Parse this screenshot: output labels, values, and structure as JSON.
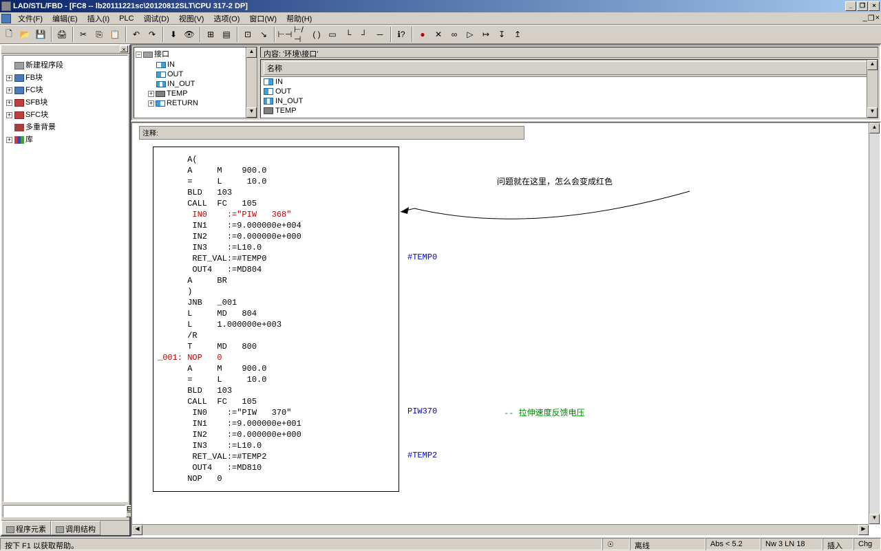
{
  "title": "LAD/STL/FBD  - [FC8 -- lb20111221sc\\20120812SLT\\CPU 317-2 DP]",
  "menus": [
    "文件(F)",
    "编辑(E)",
    "插入(I)",
    "PLC",
    "调试(D)",
    "视图(V)",
    "选项(O)",
    "窗口(W)",
    "帮助(H)"
  ],
  "tree": {
    "items": [
      {
        "icon": "new",
        "label": "新建程序段",
        "exp": ""
      },
      {
        "icon": "fb",
        "label": "FB块",
        "exp": "+"
      },
      {
        "icon": "fc",
        "label": "FC块",
        "exp": "+"
      },
      {
        "icon": "sfb",
        "label": "SFB块",
        "exp": "+"
      },
      {
        "icon": "sfc",
        "label": "SFC块",
        "exp": "+"
      },
      {
        "icon": "multi",
        "label": "多重背景",
        "exp": ""
      },
      {
        "icon": "lib",
        "label": "库",
        "exp": "+"
      }
    ]
  },
  "bottom_tabs": [
    "程序元素",
    "调用结构"
  ],
  "interface": {
    "root": "接口",
    "items": [
      {
        "icon": "in",
        "label": "IN",
        "exp": ""
      },
      {
        "icon": "out",
        "label": "OUT",
        "exp": ""
      },
      {
        "icon": "io",
        "label": "IN_OUT",
        "exp": ""
      },
      {
        "icon": "temp",
        "label": "TEMP",
        "exp": "+"
      },
      {
        "icon": "ret",
        "label": "RETURN",
        "exp": "+"
      }
    ]
  },
  "content_label": "内容:  '环境\\接口'",
  "name_header": "名称",
  "name_rows": [
    "IN",
    "OUT",
    "IN_OUT",
    "TEMP"
  ],
  "comment_label": "注释:",
  "code_lines": [
    {
      "t": "      A(",
      "c": 0
    },
    {
      "t": "      A     M    900.0",
      "c": 0
    },
    {
      "t": "      =     L     10.0",
      "c": 0
    },
    {
      "t": "      BLD   103",
      "c": 0
    },
    {
      "t": "      CALL  FC   105",
      "c": 0
    },
    {
      "t": "       IN0    :=\"PIW   368\"",
      "c": 1
    },
    {
      "t": "       IN1    :=9.000000e+004",
      "c": 0
    },
    {
      "t": "       IN2    :=0.000000e+000",
      "c": 0
    },
    {
      "t": "       IN3    :=L10.0",
      "c": 0
    },
    {
      "t": "       RET_VAL:=#TEMP0",
      "c": 0
    },
    {
      "t": "       OUT4   :=MD804",
      "c": 0
    },
    {
      "t": "      A     BR",
      "c": 0
    },
    {
      "t": "      )",
      "c": 0
    },
    {
      "t": "      JNB   _001",
      "c": 0
    },
    {
      "t": "      L     MD   804",
      "c": 0
    },
    {
      "t": "      L     1.000000e+003",
      "c": 0
    },
    {
      "t": "      /R",
      "c": 0
    },
    {
      "t": "      T     MD   800",
      "c": 0
    },
    {
      "t": "_001: NOP   0",
      "c": 1
    },
    {
      "t": "      A     M    900.0",
      "c": 0
    },
    {
      "t": "      =     L     10.0",
      "c": 0
    },
    {
      "t": "      BLD   103",
      "c": 0
    },
    {
      "t": "      CALL  FC   105",
      "c": 0
    },
    {
      "t": "       IN0    :=\"PIW   370\"",
      "c": 0
    },
    {
      "t": "       IN1    :=9.000000e+001",
      "c": 0
    },
    {
      "t": "       IN2    :=0.000000e+000",
      "c": 0
    },
    {
      "t": "       IN3    :=L10.0",
      "c": 0
    },
    {
      "t": "       RET_VAL:=#TEMP2",
      "c": 0
    },
    {
      "t": "       OUT4   :=MD810",
      "c": 0
    },
    {
      "t": "      NOP   0",
      "c": 0
    }
  ],
  "annotations": {
    "question": "问题就在这里，怎么会变成红色",
    "temp0": "#TEMP0",
    "piw370": "PIW370",
    "comment2": "-- 拉伸速度反馈电压",
    "temp2": "#TEMP2"
  },
  "status": {
    "help": "按下 F1 以获取帮助。",
    "offline": "离线",
    "abs": "Abs < 5.2",
    "pos": "Nw 3  LN 18",
    "ins": "插入",
    "chg": "Chg"
  },
  "search_placeholder": ""
}
